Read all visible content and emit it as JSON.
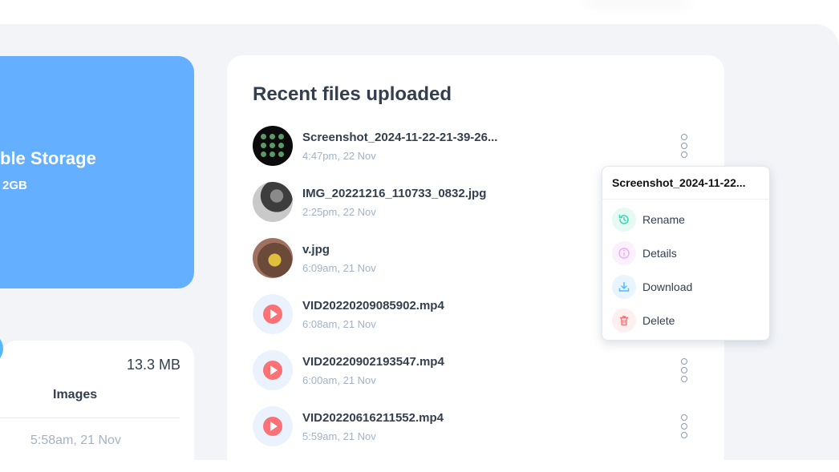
{
  "storage": {
    "title_partial": "ble Storage",
    "used_partial": "2GB"
  },
  "summary": {
    "size": "13.3 MB",
    "label": "Images",
    "date": "5:58am, 21 Nov"
  },
  "recent": {
    "title": "Recent files uploaded",
    "files": [
      {
        "name": "Screenshot_2024-11-22-21-39-26...",
        "date": "4:47pm, 22 Nov",
        "thumb": "screenshot"
      },
      {
        "name": "IMG_20221216_110733_0832.jpg",
        "date": "2:25pm, 22 Nov",
        "thumb": "photo"
      },
      {
        "name": "v.jpg",
        "date": "6:09am, 21 Nov",
        "thumb": "photo"
      },
      {
        "name": "VID20220209085902.mp4",
        "date": "6:08am, 21 Nov",
        "thumb": "video"
      },
      {
        "name": "VID20220902193547.mp4",
        "date": "6:00am, 21 Nov",
        "thumb": "video"
      },
      {
        "name": "VID20220616211552.mp4",
        "date": "5:59am, 21 Nov",
        "thumb": "video"
      }
    ]
  },
  "menu": {
    "title": "Screenshot_2024-11-22...",
    "items": [
      {
        "label": "Rename",
        "icon": "history-icon",
        "color": "#3dd9b3"
      },
      {
        "label": "Details",
        "icon": "info-icon",
        "color": "#eea8fd"
      },
      {
        "label": "Download",
        "icon": "download-icon",
        "color": "#56b8ff"
      },
      {
        "label": "Delete",
        "icon": "trash-icon",
        "color": "#fa7275"
      }
    ]
  },
  "colors": {
    "brand_blue": "#56b8ff",
    "storage_card": "#64afff",
    "accent_red": "#fa7275",
    "background": "#f2f4f8"
  }
}
